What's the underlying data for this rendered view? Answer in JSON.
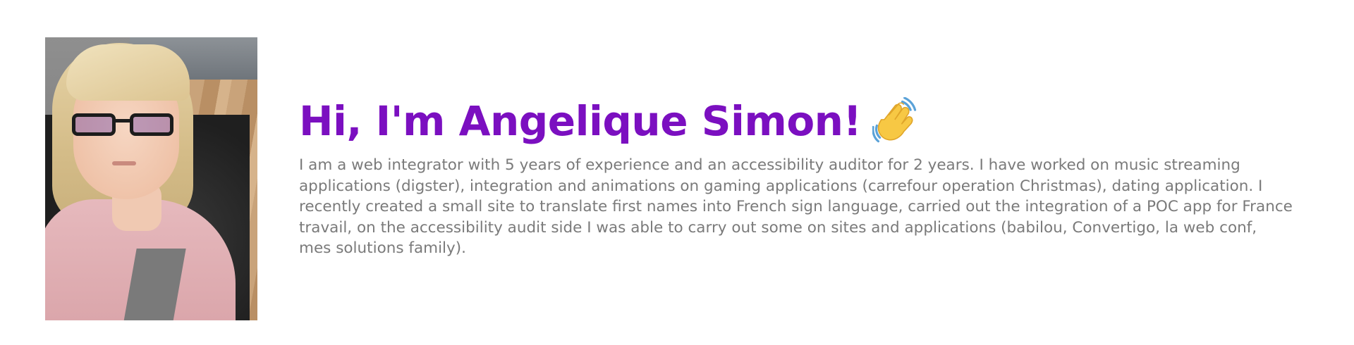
{
  "profile": {
    "heading": "Hi, I'm Angelique Simon!",
    "heading_icon": "waving-hand-icon",
    "bio": "I am a web integrator with 5 years of experience and an accessibility auditor for 2 years. I have worked on music streaming applications (digster), integration and animations on gaming applications (carrefour operation Christmas), dating application. I recently created a small site to translate first names into French sign language, carried out the integration of a POC app for France travail, on the accessibility audit side I was able to carry out some on sites and applications (babilou, Convertigo, la web conf, mes solutions family)."
  },
  "colors": {
    "heading": "#7b0fc0",
    "body_text": "#7a7a7a",
    "background": "#ffffff"
  }
}
